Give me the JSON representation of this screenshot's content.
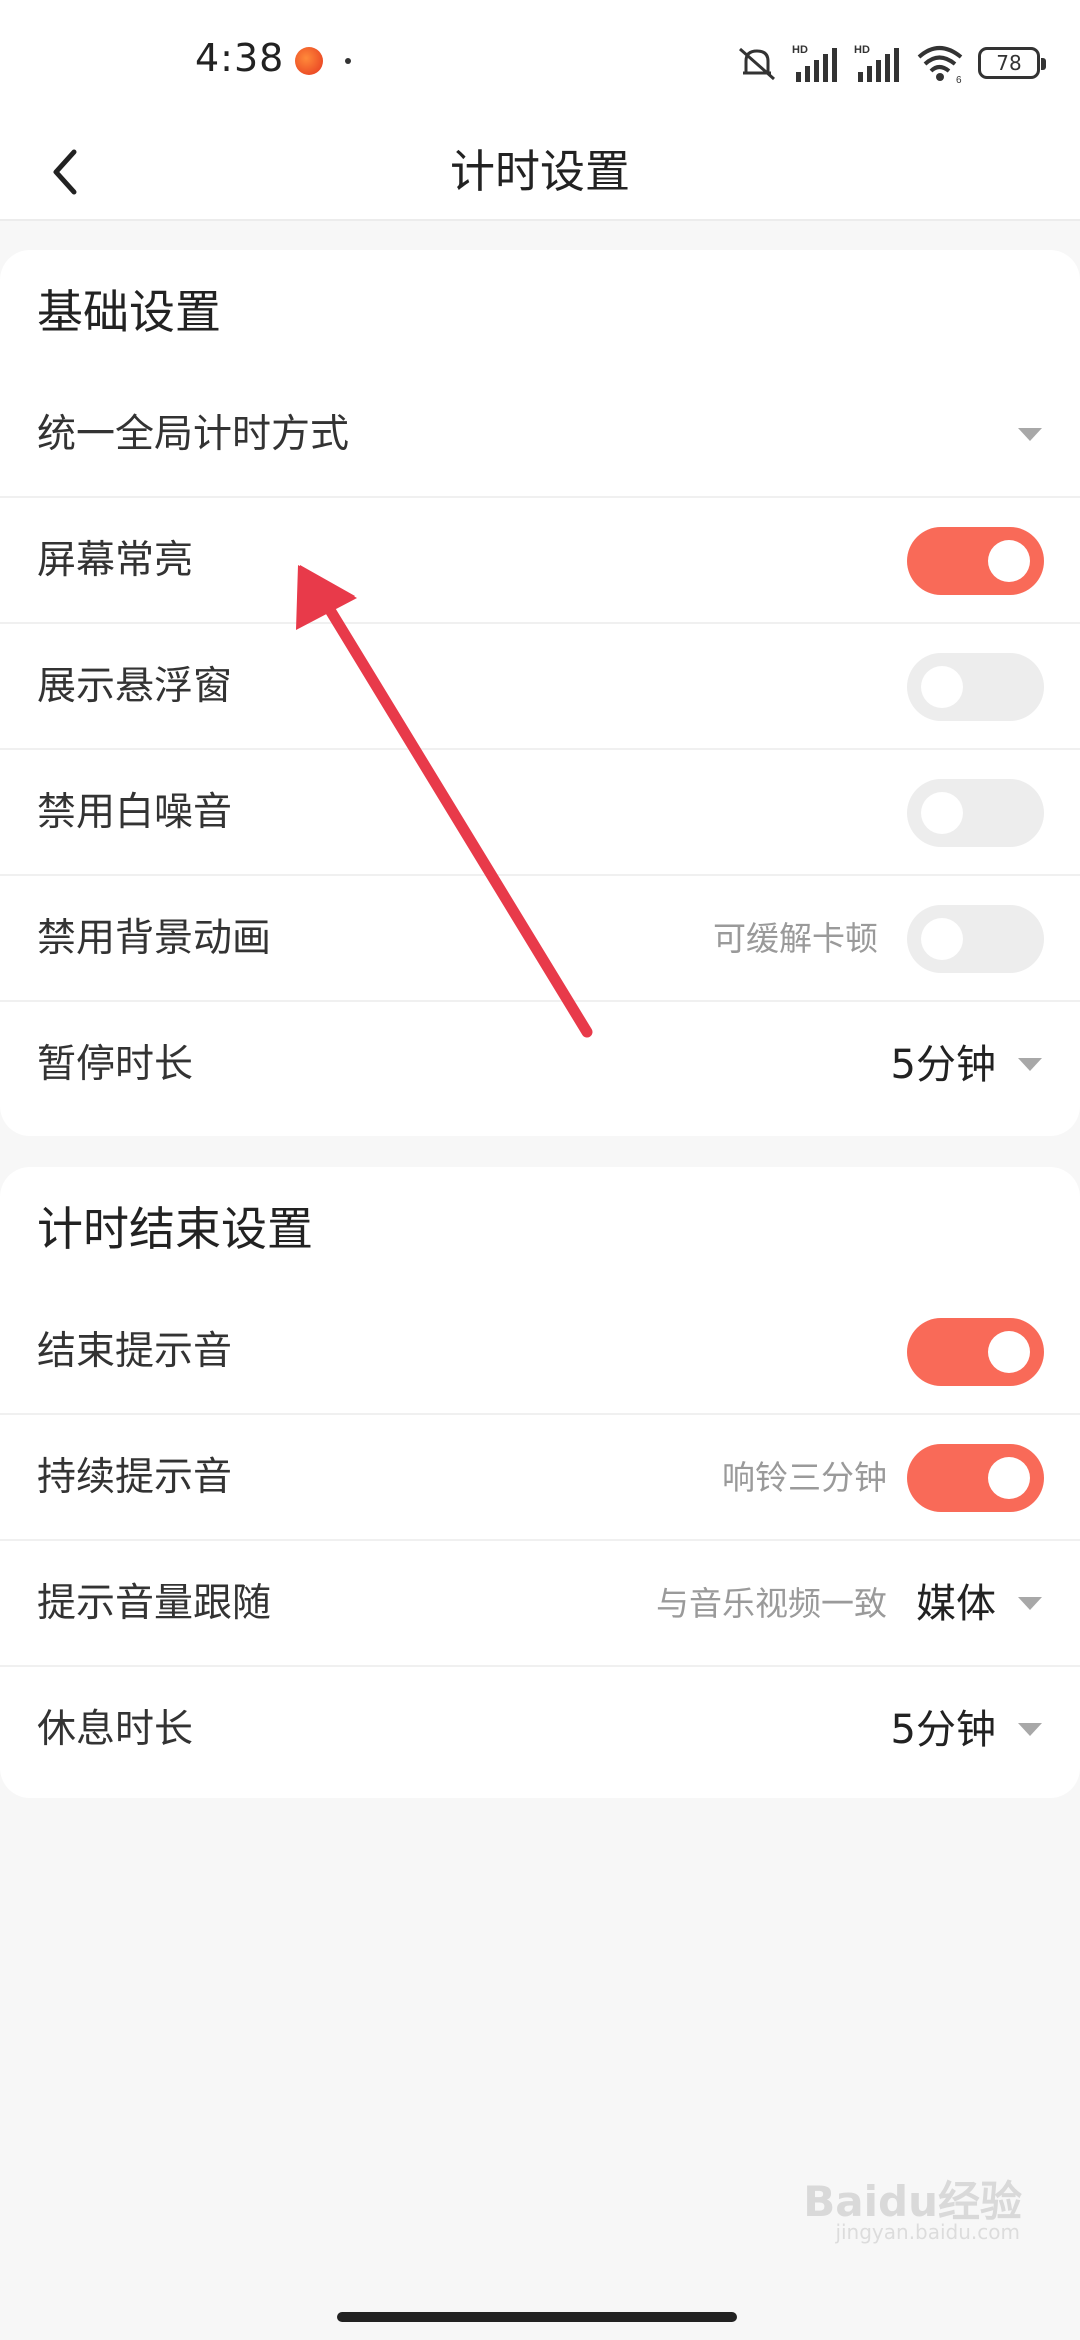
{
  "status_bar": {
    "time": "4:38",
    "battery": "78",
    "icons": [
      "app-icon",
      "mute-icon",
      "signal-hd-icon",
      "signal-hd-icon",
      "wifi-icon",
      "battery-icon"
    ]
  },
  "header": {
    "title": "计时设置",
    "back_icon": "chevron-left-icon"
  },
  "basic_settings": {
    "title": "基础设置",
    "rows": [
      {
        "label": "统一全局计时方式",
        "control": "dropdown"
      },
      {
        "label": "屏幕常亮",
        "control": "toggle",
        "on": true
      },
      {
        "label": "展示悬浮窗",
        "control": "toggle",
        "on": false
      },
      {
        "label": "禁用白噪音",
        "control": "toggle",
        "on": false
      },
      {
        "label": "禁用背景动画",
        "hint": "可缓解卡顿",
        "control": "toggle",
        "on": false
      },
      {
        "label": "暂停时长",
        "value": "5分钟",
        "control": "dropdown"
      }
    ]
  },
  "end_settings": {
    "title": "计时结束设置",
    "rows": [
      {
        "label": "结束提示音",
        "control": "toggle",
        "on": true
      },
      {
        "label": "持续提示音",
        "hint": "响铃三分钟",
        "control": "toggle",
        "on": true
      },
      {
        "label": "提示音量跟随",
        "hint": "与音乐视频一致",
        "value": "媒体",
        "control": "dropdown"
      },
      {
        "label": "休息时长",
        "value": "5分钟",
        "control": "dropdown"
      }
    ]
  },
  "watermark": {
    "brand": "Baidu经验",
    "url": "jingyan.baidu.com"
  },
  "colors": {
    "accent": "#f96a58",
    "toggle_off": "#ededed",
    "annotation_arrow": "#e83a4a"
  }
}
